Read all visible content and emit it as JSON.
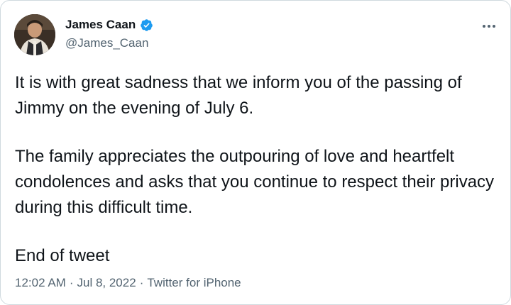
{
  "author": {
    "display_name": "James Caan",
    "handle": "@James_Caan",
    "verified": true,
    "avatar_icon": "profile-photo"
  },
  "menu": {
    "icon": "more-horizontal-icon"
  },
  "tweet": {
    "paragraphs": [
      "It is with great sadness that we inform you of the passing of Jimmy on the evening of July 6.",
      "The family appreciates the outpouring of love and heartfelt condolences and asks that you continue to respect their privacy during this difficult time.",
      "End of tweet"
    ]
  },
  "meta": {
    "time": "12:02 AM",
    "date": "Jul 8, 2022",
    "source": "Twitter for iPhone",
    "separator": "·"
  },
  "colors": {
    "text_primary": "#0f1419",
    "text_secondary": "#536471",
    "verified_blue": "#1d9bf0",
    "border": "#cfd9de"
  }
}
